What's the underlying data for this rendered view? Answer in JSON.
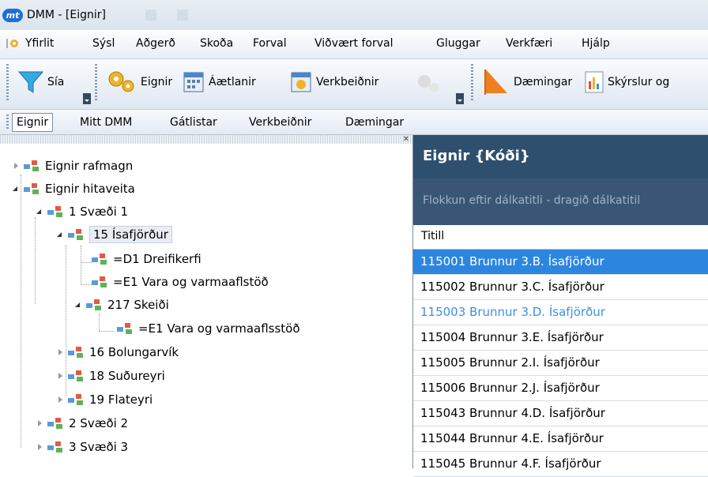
{
  "window": {
    "title": "DMM - [Eignir]",
    "logo": "mt"
  },
  "menu": [
    "Yfirlit",
    "Sýsl",
    "Aðgerð",
    "Skoða",
    "Forval",
    "Viðvært forval",
    "Gluggar",
    "Verkfæri",
    "Hjálp"
  ],
  "toolbar": {
    "filter_label": "Sía",
    "assets_label": "Eignir",
    "plans_label": "Áætlanir",
    "work_orders_label": "Verkbeiðnir",
    "samples_label": "Dæmingar",
    "reports_label": "Skýrslur og"
  },
  "tabs": [
    "Eignir",
    "Mitt DMM",
    "Gátlistar",
    "Verkbeiðnir",
    "Dæmingar"
  ],
  "tree": [
    {
      "label": "Eignir rafmagn"
    },
    {
      "label": "Eignir hitaveita"
    },
    {
      "label": "1 Svæði 1"
    },
    {
      "label": "15 Ísafjörður"
    },
    {
      "label": "=D1 Dreifikerfi"
    },
    {
      "label": "=E1 Vara og varmaaflstöð"
    },
    {
      "label": "217 Skeiði"
    },
    {
      "label": "=E1 Vara og varmaaflsstöð"
    },
    {
      "label": "16 Bolungarvík"
    },
    {
      "label": "18 Suðureyri"
    },
    {
      "label": "19 Flateyri"
    },
    {
      "label": "2 Svæði 2"
    },
    {
      "label": "3 Svæði 3"
    }
  ],
  "grid": {
    "title": "Eignir {Kóði}",
    "group_hint": "Flokkun eftir dálkatitli - dragið dálkatitil",
    "column": "Titill",
    "rows": [
      "115001 Brunnur 3.B. Ísafjörður",
      "115002 Brunnur 3.C. Ísafjörður",
      "115003 Brunnur 3.D. Ísafjörður",
      "115004 Brunnur 3.E. Ísafjörður",
      "115005 Brunnur 2.I. Ísafjörður",
      "115006 Brunnur 2.J. Ísafjörður",
      "115043 Brunnur 4.D. Ísafjörður",
      "115044 Brunnur 4.E. Ísafjörður",
      "115045 Brunnur 4.F. Ísafjörður"
    ]
  },
  "colors": {
    "accent": "#2c86e0",
    "grid_header": "#2f4f6f",
    "link": "#3d90e0"
  }
}
